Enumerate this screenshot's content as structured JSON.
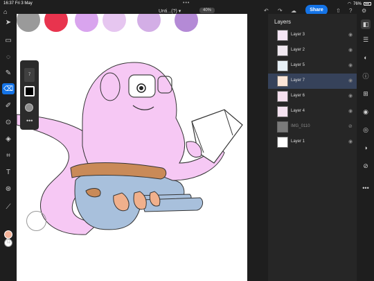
{
  "status": {
    "time": "16:37",
    "date": "Fri 3 May",
    "battery": "76%"
  },
  "toolbar": {
    "document_title": "Unti...(?) ▾",
    "zoom": "40%",
    "share_label": "Share"
  },
  "layers_panel": {
    "title": "Layers",
    "layers": [
      {
        "name": "Layer 3",
        "visible": true
      },
      {
        "name": "Layer 2",
        "visible": true
      },
      {
        "name": "Layer 5",
        "visible": true
      },
      {
        "name": "Layer 7",
        "visible": true,
        "selected": true
      },
      {
        "name": "Layer 6",
        "visible": true
      },
      {
        "name": "Layer 4",
        "visible": true
      },
      {
        "name": "IMG_0110",
        "visible": false
      },
      {
        "name": "Layer 1",
        "visible": true
      }
    ]
  },
  "brush_panel": {
    "size_label": "7"
  },
  "colors": {
    "accent": "#1473e6",
    "foreground": "#f4b49a",
    "background": "#ffffff",
    "swatches": [
      "#9a9a9a",
      "#e8344e",
      "#d9a4ee",
      "#e6c6f0",
      "#d3aee6",
      "#b48ad6"
    ]
  },
  "icons": {
    "left_tools": [
      "move-icon",
      "select-icon",
      "lasso-icon",
      "brush-icon",
      "eraser-icon",
      "smudge-icon",
      "clone-icon",
      "fill-icon",
      "crop-icon",
      "type-icon",
      "pattern-icon",
      "eyedropper-icon"
    ],
    "right_tools": [
      "layers-icon",
      "adjustments-icon",
      "filters-icon",
      "info-icon",
      "add-layer-icon",
      "visibility-icon",
      "mask-icon",
      "clip-icon",
      "hide-icon",
      "more-icon"
    ]
  }
}
